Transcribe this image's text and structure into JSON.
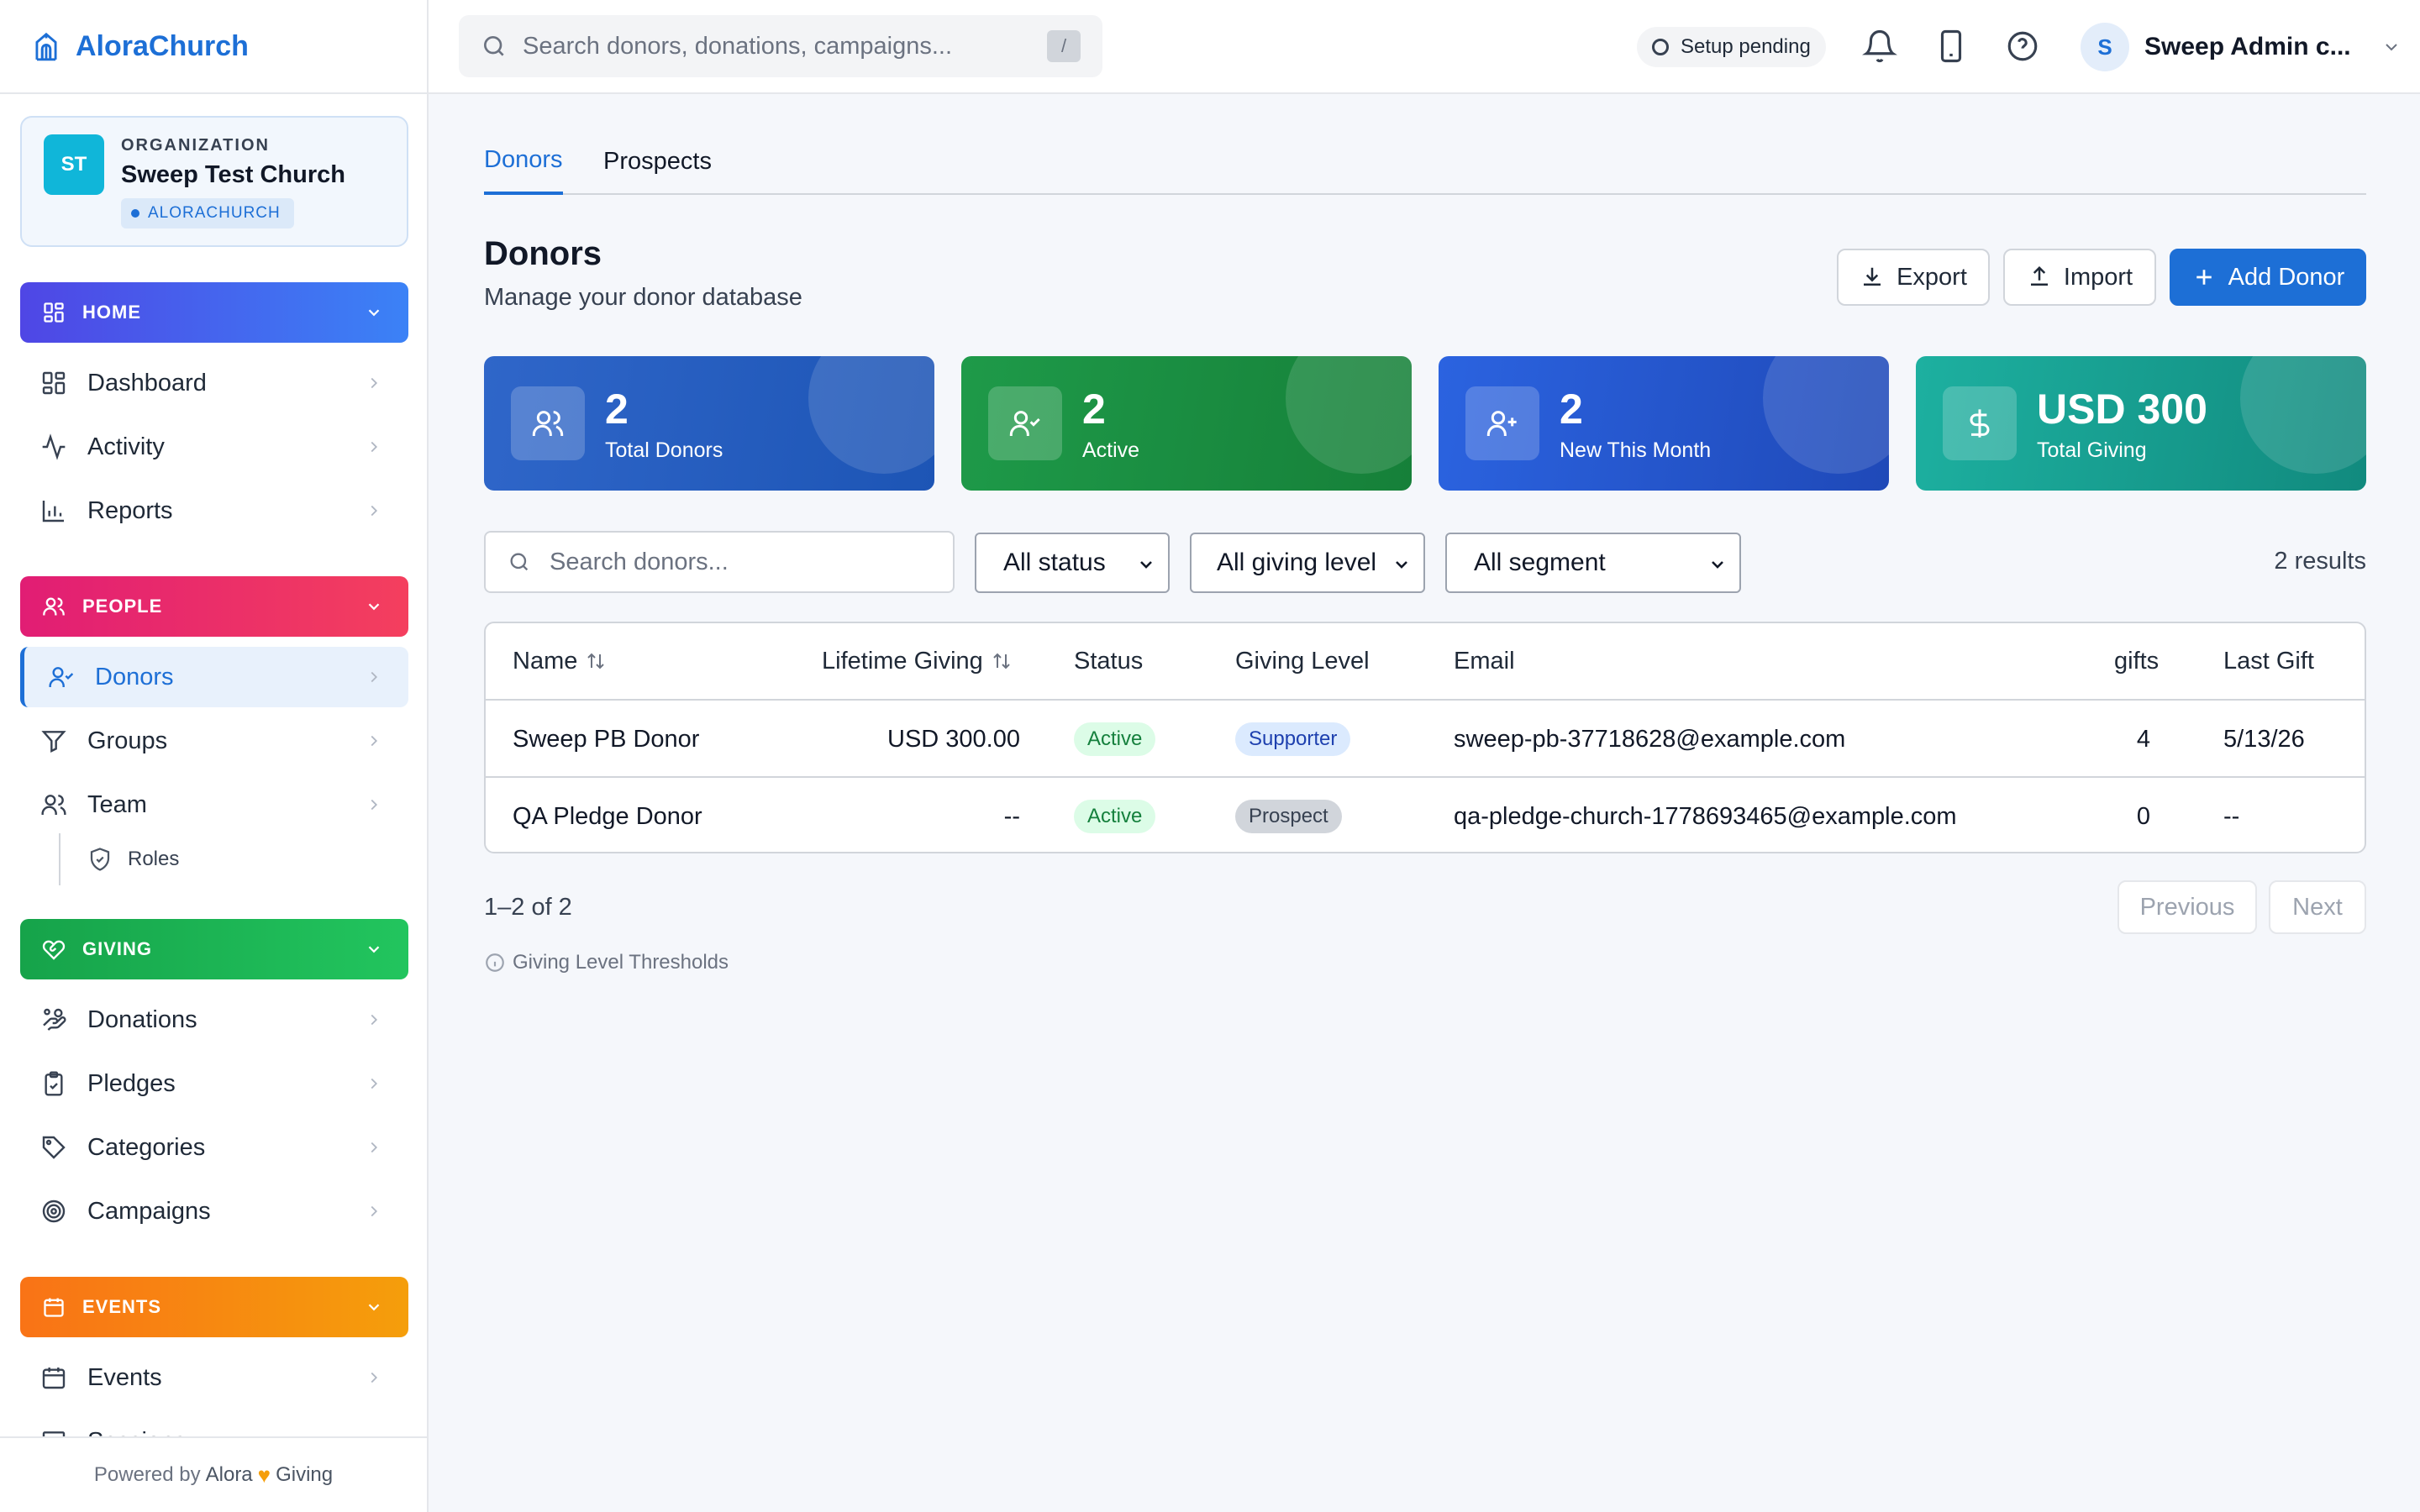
{
  "brand": {
    "name": "AloraChurch"
  },
  "organization": {
    "initials": "ST",
    "kicker": "ORGANIZATION",
    "name": "Sweep Test Church",
    "tag": "ALORACHURCH"
  },
  "sidebar": {
    "home": {
      "label": "HOME",
      "items": [
        {
          "label": "Dashboard",
          "icon": "dashboard-icon"
        },
        {
          "label": "Activity",
          "icon": "activity-icon"
        },
        {
          "label": "Reports",
          "icon": "bar-chart-icon"
        }
      ]
    },
    "people": {
      "label": "PEOPLE",
      "items": [
        {
          "label": "Donors",
          "icon": "user-check-icon",
          "active": true
        },
        {
          "label": "Groups",
          "icon": "filter-icon"
        },
        {
          "label": "Team",
          "icon": "users-icon"
        }
      ],
      "sub_items": [
        {
          "label": "Roles",
          "icon": "shield-icon"
        }
      ]
    },
    "giving": {
      "label": "GIVING",
      "items": [
        {
          "label": "Donations",
          "icon": "hand-coins-icon"
        },
        {
          "label": "Pledges",
          "icon": "clipboard-check-icon"
        },
        {
          "label": "Categories",
          "icon": "tag-icon"
        },
        {
          "label": "Campaigns",
          "icon": "target-icon"
        }
      ]
    },
    "events": {
      "label": "EVENTS",
      "items": [
        {
          "label": "Events",
          "icon": "calendar-icon"
        },
        {
          "label": "Sessions",
          "icon": "monitor-icon"
        }
      ]
    },
    "footer": {
      "prefix": "Powered by",
      "brand": "Alora",
      "suffix": "Giving"
    }
  },
  "topbar": {
    "search_placeholder": "Search donors, donations, campaigns...",
    "shortcut": "/",
    "setup_status": "Setup pending",
    "user_initial": "S",
    "user_name": "Sweep Admin c..."
  },
  "tabs": [
    {
      "label": "Donors",
      "active": true
    },
    {
      "label": "Prospects",
      "active": false
    }
  ],
  "page": {
    "title": "Donors",
    "subtitle": "Manage your donor database",
    "actions": {
      "export": "Export",
      "import": "Import",
      "add": "Add Donor"
    }
  },
  "stats": [
    {
      "value": "2",
      "label": "Total Donors",
      "icon": "users-icon",
      "color": "#2f66c9"
    },
    {
      "value": "2",
      "label": "Active",
      "icon": "user-check-icon",
      "color": "#1e9a49"
    },
    {
      "value": "2",
      "label": "New This Month",
      "icon": "user-plus-icon",
      "color": "#2b63e0"
    },
    {
      "value": "USD 300",
      "label": "Total Giving",
      "icon": "dollar-icon",
      "color": "#1db0a0"
    }
  ],
  "filters": {
    "search_placeholder": "Search donors...",
    "status": "All status",
    "giving_level": "All giving level",
    "segment": "All segment",
    "results": "2 results"
  },
  "table": {
    "columns": {
      "name": "Name",
      "lifetime": "Lifetime Giving",
      "status": "Status",
      "level": "Giving Level",
      "email": "Email",
      "gifts": "gifts",
      "last_gift": "Last Gift"
    },
    "rows": [
      {
        "name": "Sweep PB Donor",
        "lifetime": "USD 300.00",
        "status": "Active",
        "level": "Supporter",
        "email": "sweep-pb-37718628@example.com",
        "gifts": "4",
        "last_gift": "5/13/26"
      },
      {
        "name": "QA Pledge Donor",
        "lifetime": "--",
        "status": "Active",
        "level": "Prospect",
        "email": "qa-pledge-church-1778693465@example.com",
        "gifts": "0",
        "last_gift": "--"
      }
    ]
  },
  "pagination": {
    "range": "1–2 of 2",
    "previous": "Previous",
    "next": "Next"
  },
  "thresholds_link": "Giving Level Thresholds",
  "colors": {
    "accent": "#1d6fd6",
    "home": "#4f46e5",
    "people": "#e11d74",
    "giving": "#16a34a",
    "events": "#f97316"
  }
}
